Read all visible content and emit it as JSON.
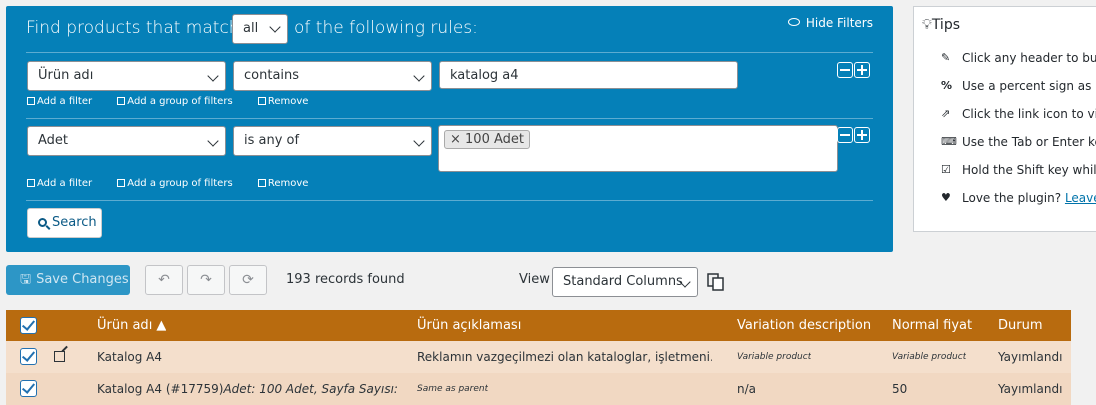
{
  "filter": {
    "title_pre": "Find products that match",
    "match_value": "all",
    "title_post": "of the following rules:",
    "hide_filters": "Hide Filters",
    "rule1": {
      "field": "Ürün adı",
      "operator": "contains",
      "value": "katalog a4"
    },
    "rule2": {
      "field": "Adet",
      "operator": "is any of",
      "tag": "× 100 Adet"
    },
    "add_filter": "Add a filter",
    "add_group": "Add a group of filters",
    "remove": "Remove",
    "search": "Search"
  },
  "tips": {
    "title": "Tips",
    "items": [
      {
        "icon": "wand-icon",
        "text": "Click any header to bul"
      },
      {
        "icon": "percent-icon",
        "text": "Use a percent sign as a"
      },
      {
        "icon": "external-link-icon",
        "text": "Click the link icon to vie"
      },
      {
        "icon": "keyboard-icon",
        "text": "Use the Tab or Enter ke"
      },
      {
        "icon": "checkbox-icon",
        "text": "Hold the Shift key while"
      },
      {
        "icon": "heart-icon",
        "text": "Love the plugin?",
        "link": "Leave"
      }
    ]
  },
  "toolbar": {
    "save": "Save Changes",
    "records": "193 records found",
    "view_label": "View",
    "view_value": "Standard Columns"
  },
  "table": {
    "headers": [
      "Ürün adı ▲",
      "Ürün açıklaması",
      "Variation description",
      "Normal fiyat",
      "Durum"
    ],
    "rows": [
      {
        "name": "Katalog A4",
        "desc": "Reklamın vazgeçilmezi olan kataloglar, işletmeni...",
        "variation": "Variable product",
        "price": "Variable product",
        "status": "Yayımlandı"
      },
      {
        "name": "Katalog A4 (#17759)",
        "name_italic": "Adet: 100 Adet, Sayfa Sayısı: ...",
        "desc": "Same as parent",
        "variation": "n/a",
        "price": "50",
        "status": "Yayımlandı"
      }
    ]
  }
}
